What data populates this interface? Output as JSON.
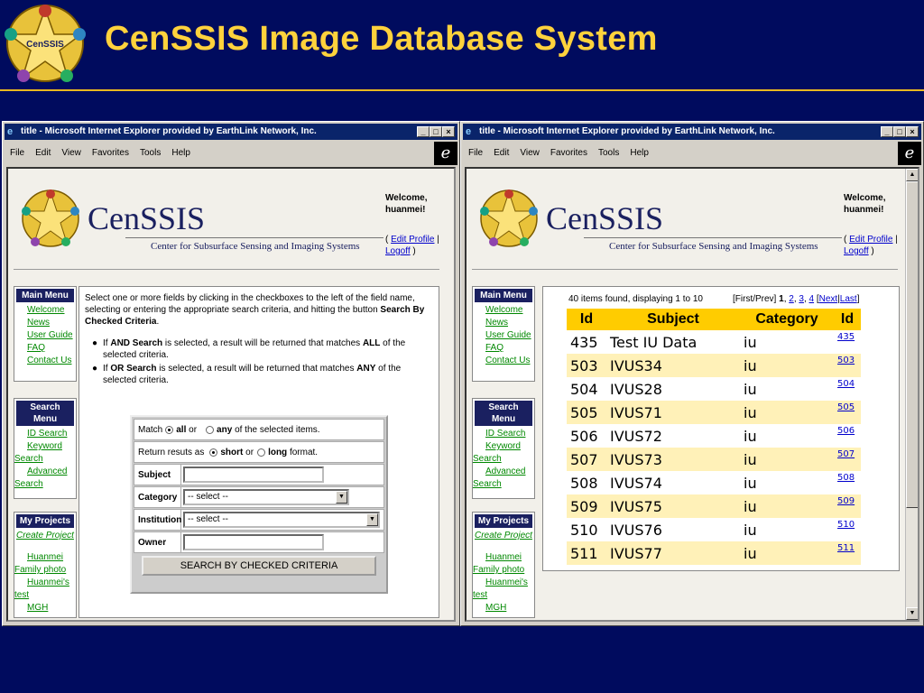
{
  "slide": {
    "title": "CenSSIS Image Database System",
    "logo_text": "CenSSIS",
    "accent": "#ffd23c",
    "background": "#000b5e"
  },
  "browser": {
    "title": "title - Microsoft Internet Explorer provided by EarthLink Network, Inc.",
    "menu": [
      "File",
      "Edit",
      "View",
      "Favorites",
      "Tools",
      "Help"
    ]
  },
  "site": {
    "name": "CenSSIS",
    "tagline": "Center for Subsurface Sensing and Imaging Systems",
    "welcome": "Welcome, huanmei!",
    "edit_profile": "Edit Profile",
    "logoff": "Logoff"
  },
  "sidebar": {
    "main_menu": {
      "title": "Main Menu",
      "items": [
        "Welcome",
        "News",
        "User Guide",
        "FAQ",
        "Contact Us"
      ]
    },
    "search_menu": {
      "title": "Search Menu",
      "items": [
        "ID Search",
        "Keyword Search",
        "Advanced Search"
      ]
    },
    "my_projects": {
      "title": "My Projects",
      "create": "Create Project",
      "items": [
        "Huanmei Family photo",
        "Huanmei's test",
        "MGH"
      ]
    }
  },
  "search_page": {
    "intro_a": "Select one or more fields by clicking in the checkboxes to the left of the field name, selecting or entering the appropriate search criteria, and hitting the button ",
    "intro_b": "Search By Checked Criteria",
    "bullet1_a": "If ",
    "bullet1_b": "AND Search",
    "bullet1_c": " is selected, a result will be returned that matches ",
    "bullet1_d": "ALL",
    "bullet1_e": " of the selected criteria.",
    "bullet2_a": "If ",
    "bullet2_b": "OR Search",
    "bullet2_c": " is selected, a result will be returned that matches ",
    "bullet2_d": "ANY",
    "bullet2_e": " of the selected criteria.",
    "form": {
      "match_label": "Match",
      "match_all": "all",
      "match_or": "or",
      "match_any": "any",
      "match_suffix": "of the selected items.",
      "return_label": "Return resuts as",
      "short": "short",
      "return_or": "or",
      "long": "long",
      "format": "format.",
      "subject_label": "Subject",
      "category_label": "Category",
      "category_value": "-- select --",
      "institution_label": "Institution",
      "institution_value": "-- select --",
      "owner_label": "Owner",
      "submit": "SEARCH BY CHECKED CRITERIA"
    }
  },
  "results_page": {
    "summary": "40 items found, displaying 1 to 10",
    "pager": {
      "first_prev": "[First/Prev]",
      "current": "1",
      "p2": "2",
      "p3": "3",
      "p4": "4",
      "next": "Next",
      "last": "Last"
    },
    "headers": [
      "Id",
      "Subject",
      "Category",
      "Id"
    ],
    "rows": [
      {
        "id": "435",
        "subject": "Test IU Data",
        "category": "iu",
        "link": "435"
      },
      {
        "id": "503",
        "subject": "IVUS34",
        "category": "iu",
        "link": "503"
      },
      {
        "id": "504",
        "subject": "IVUS28",
        "category": "iu",
        "link": "504"
      },
      {
        "id": "505",
        "subject": "IVUS71",
        "category": "iu",
        "link": "505"
      },
      {
        "id": "506",
        "subject": "IVUS72",
        "category": "iu",
        "link": "506"
      },
      {
        "id": "507",
        "subject": "IVUS73",
        "category": "iu",
        "link": "507"
      },
      {
        "id": "508",
        "subject": "IVUS74",
        "category": "iu",
        "link": "508"
      },
      {
        "id": "509",
        "subject": "IVUS75",
        "category": "iu",
        "link": "509"
      },
      {
        "id": "510",
        "subject": "IVUS76",
        "category": "iu",
        "link": "510"
      },
      {
        "id": "511",
        "subject": "IVUS77",
        "category": "iu",
        "link": "511"
      }
    ]
  }
}
